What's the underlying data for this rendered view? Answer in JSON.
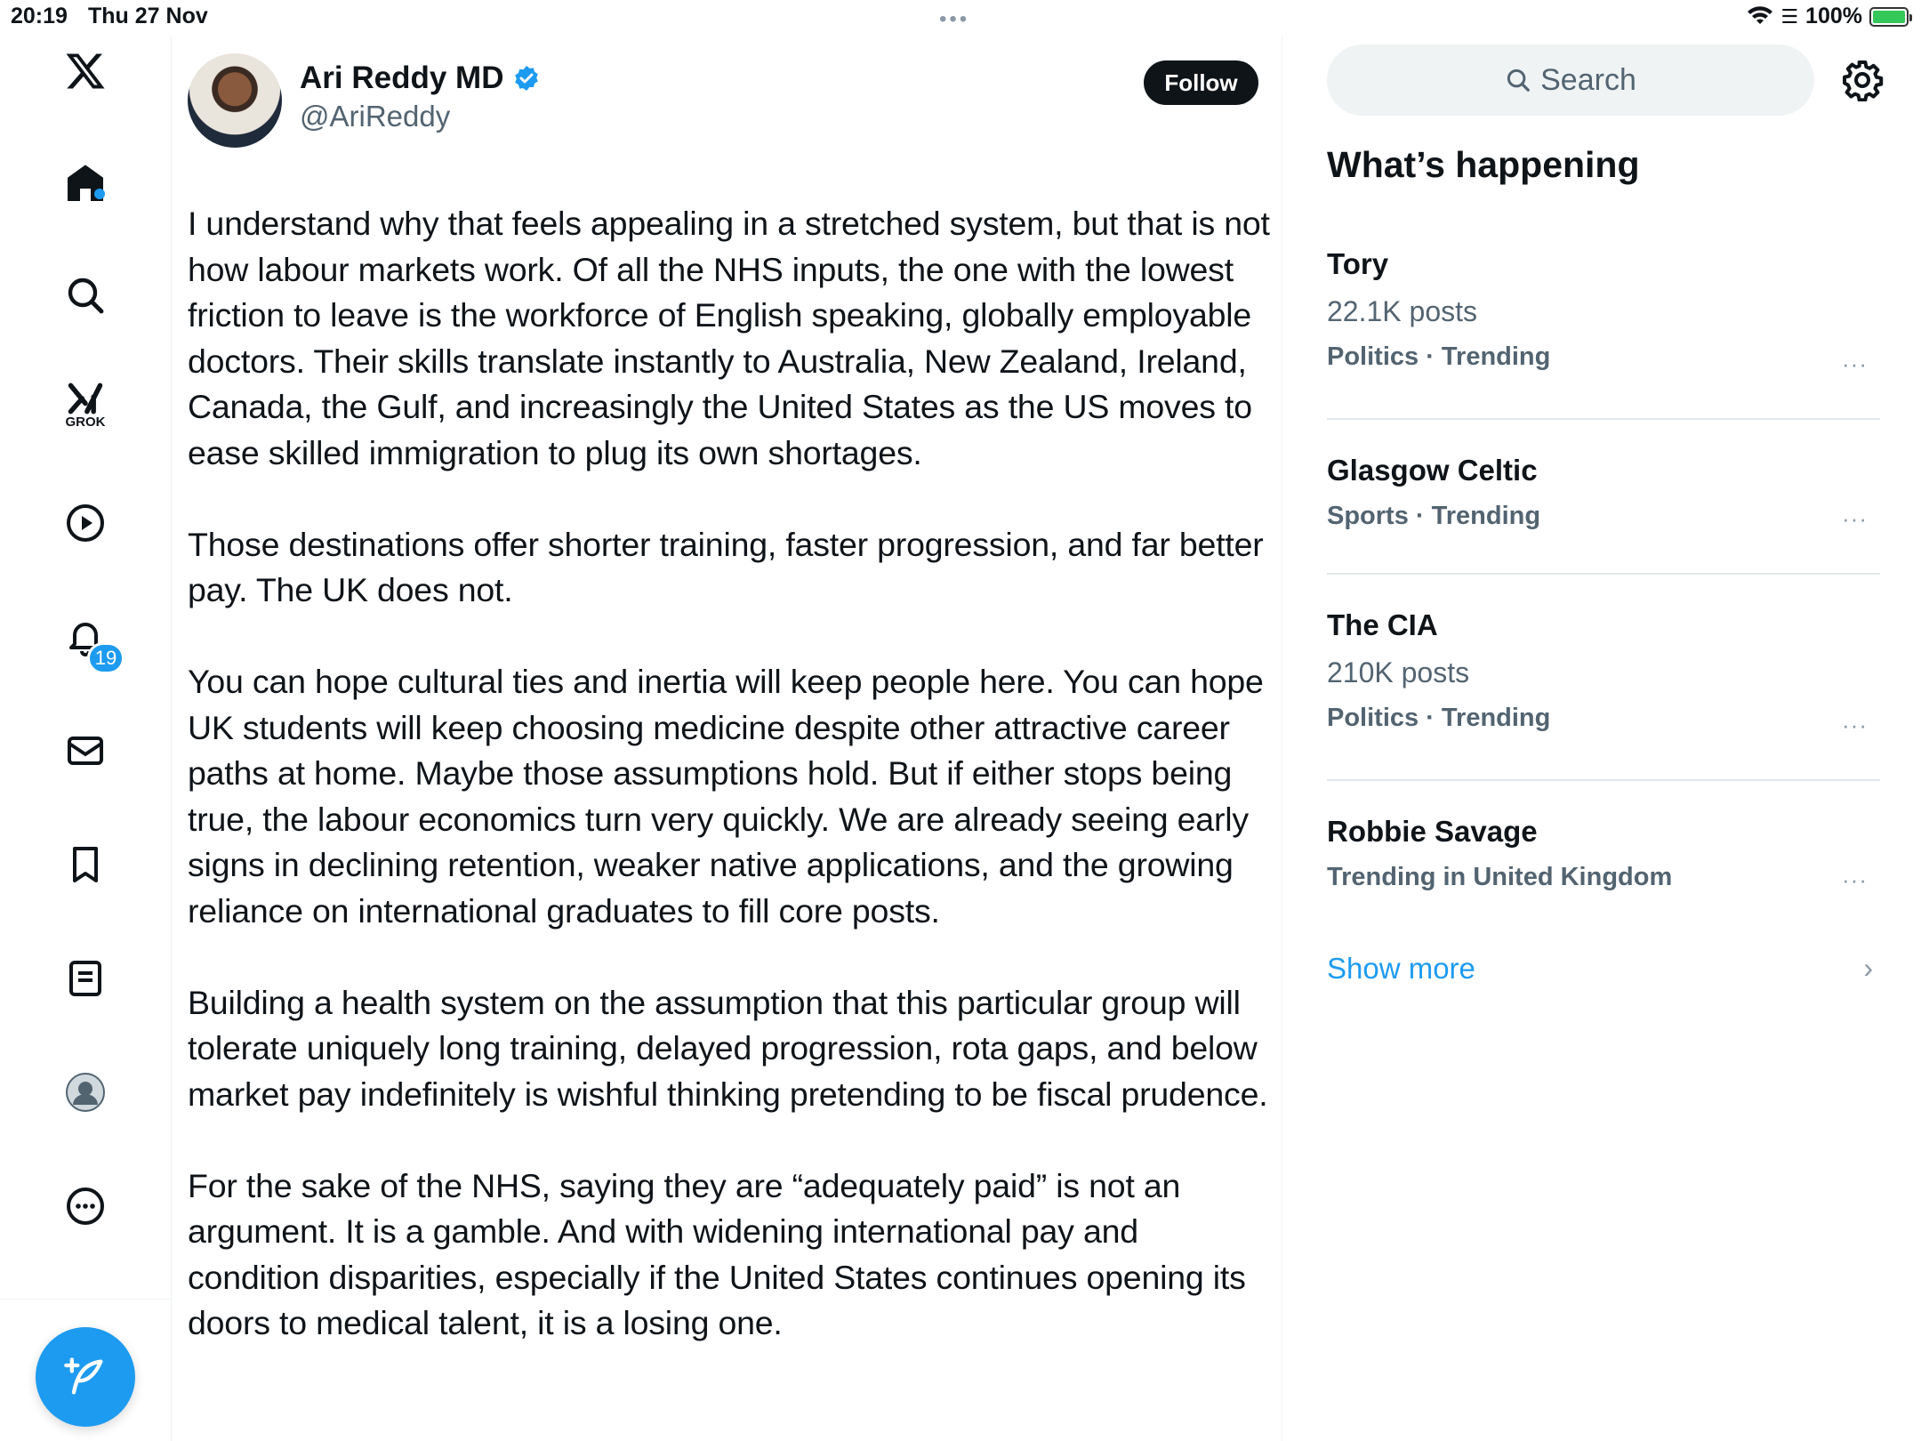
{
  "status_bar": {
    "time": "20:19",
    "date": "Thu 27 Nov",
    "battery": "100%",
    "battery_level": 1.0
  },
  "nav": {
    "grok_label": "GROK",
    "notifications_count": "19",
    "icons": [
      "x-logo-icon",
      "home-icon",
      "search-icon",
      "grok-icon",
      "video-icon",
      "bell-icon",
      "mail-icon",
      "bookmark-icon",
      "list-icon",
      "profile-icon",
      "more-icon",
      "compose-icon"
    ]
  },
  "post": {
    "author_name": "Ari Reddy MD",
    "author_handle": "@AriReddy",
    "verified": true,
    "follow_label": "Follow",
    "paragraphs": [
      "I understand why that feels appealing in a stretched system, but that is not how labour markets work. Of all the NHS inputs, the one with the lowest friction to leave is the workforce of English speaking, globally employable doctors. Their skills translate instantly to Australia, New Zealand, Ireland, Canada, the Gulf, and increasingly the United States as the US moves to ease skilled immigration to plug its own shortages.",
      "Those destinations offer shorter training, faster progression, and far better pay. The UK does not.",
      "You can hope cultural ties and inertia will keep people here. You can hope UK students will keep choosing medicine despite other attractive career paths at home. Maybe those assumptions hold. But if either stops being true, the labour economics turn very quickly. We are already seeing early signs in declining retention, weaker native applications, and the growing reliance on international graduates to fill core posts.",
      "Building a health system on the assumption that this particular group will tolerate uniquely long training, delayed progression, rota gaps, and below market pay indefinitely is wishful thinking pretending to be fiscal prudence.",
      "For the sake of the NHS, saying they are “adequately paid” is not an argument. It is a gamble. And with widening international pay and condition disparities, especially if the United States continues opening its doors to medical talent, it is a losing one."
    ]
  },
  "sidebar": {
    "search_placeholder": "Search",
    "heading": "What’s happening",
    "trends": [
      {
        "title": "Tory",
        "posts": "22.1K posts",
        "category": "Politics · Trending"
      },
      {
        "title": "Glasgow Celtic",
        "posts": "",
        "category": "Sports · Trending"
      },
      {
        "title": "The CIA",
        "posts": "210K posts",
        "category": "Politics · Trending"
      },
      {
        "title": "Robbie Savage",
        "posts": "",
        "category": "Trending in United Kingdom"
      }
    ],
    "more_glyph": "···",
    "show_more": "Show more",
    "show_more_chevron": "›"
  },
  "colors": {
    "accent": "#1d9bf0",
    "text": "#0f1419",
    "secondary": "#536471"
  }
}
